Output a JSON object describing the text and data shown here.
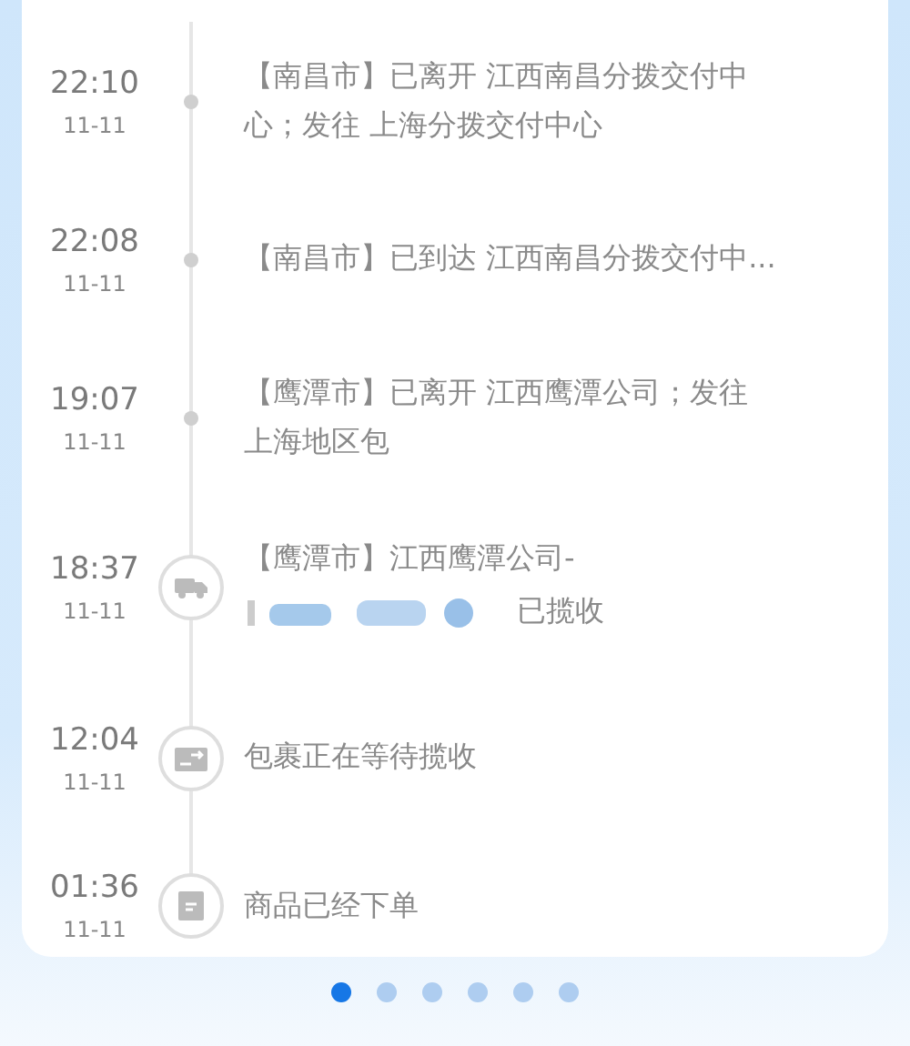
{
  "events": [
    {
      "time": "22:10",
      "date": "11-11",
      "kind": "dot",
      "lines": [
        "【南昌市】已离开 江西南昌分拨交付中",
        "心；发往 上海分拨交付中心"
      ]
    },
    {
      "time": "22:08",
      "date": "11-11",
      "kind": "dot",
      "lines": [
        "【南昌市】已到达 江西南昌分拨交付中..."
      ]
    },
    {
      "time": "19:07",
      "date": "11-11",
      "kind": "dot",
      "lines": [
        "【鹰潭市】已离开 江西鹰潭公司；发往",
        "上海地区包"
      ]
    },
    {
      "time": "18:37",
      "date": "11-11",
      "kind": "truck",
      "lines": [
        "【鹰潭市】江西鹰潭公司-"
      ],
      "blurred": true,
      "tail": "已揽收"
    },
    {
      "time": "12:04",
      "date": "11-11",
      "kind": "transfer",
      "lines": [
        "包裹正在等待揽收"
      ]
    },
    {
      "time": "01:36",
      "date": "11-11",
      "kind": "order",
      "lines": [
        "商品已经下单"
      ]
    }
  ],
  "pages": [
    {
      "selected": true
    },
    {
      "selected": false
    },
    {
      "selected": false
    },
    {
      "selected": false
    },
    {
      "selected": false
    },
    {
      "selected": false
    }
  ]
}
